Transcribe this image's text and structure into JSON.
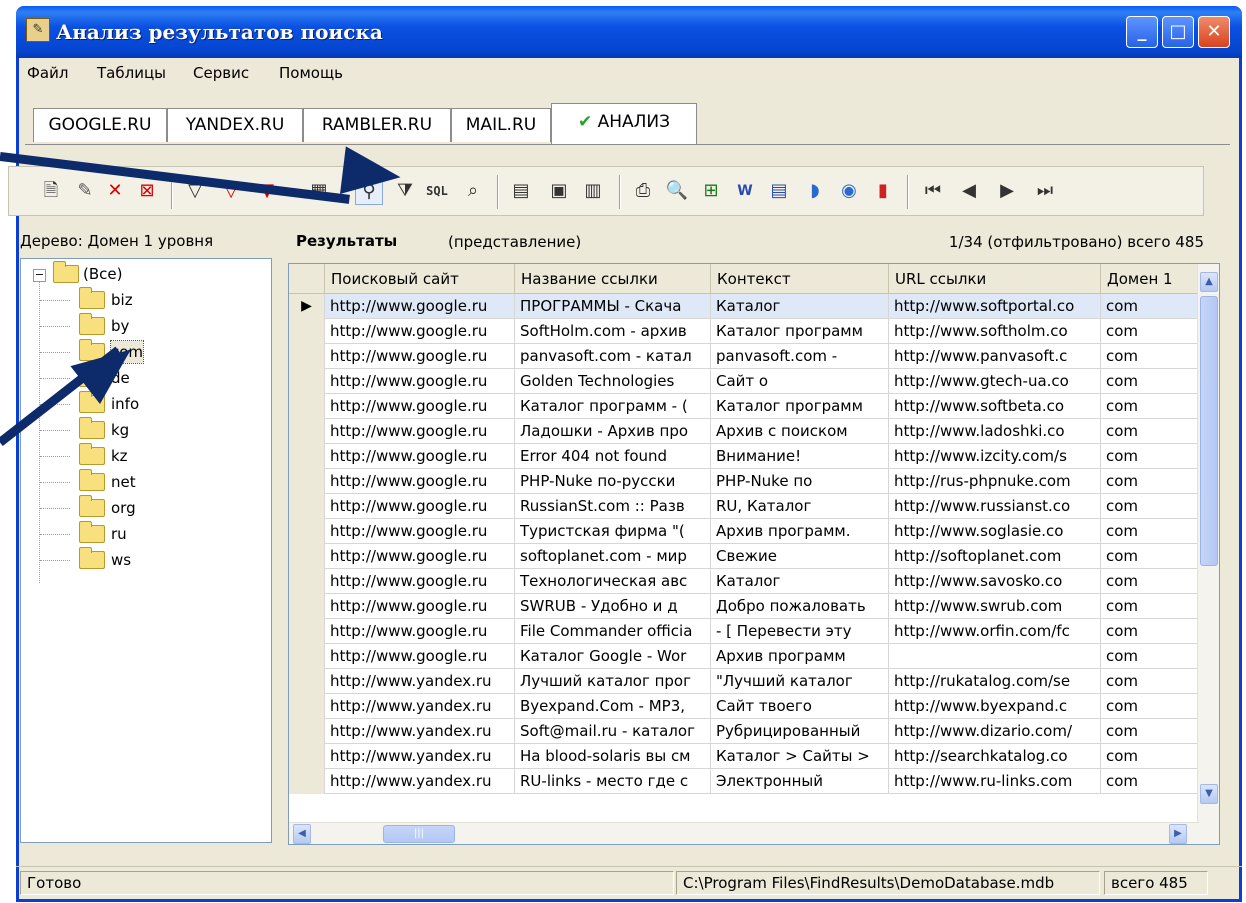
{
  "window": {
    "title": "Анализ результатов поиска",
    "colors": {
      "titlebar": "#0a50e4",
      "face": "#ece9d8",
      "selection": "#dfe8f6",
      "arrow": "#0d2a6b"
    }
  },
  "menu": {
    "items": [
      "Файл",
      "Таблицы",
      "Сервис",
      "Помощь"
    ]
  },
  "tabs": {
    "items": [
      "GOOGLE.RU",
      "YANDEX.RU",
      "RAMBLER.RU",
      "MAIL.RU",
      "АНАЛИЗ"
    ],
    "active": "АНАЛИЗ"
  },
  "toolbar": {
    "icons": [
      "new-record-icon",
      "edit-icon",
      "delete-icon",
      "delete-all-icon",
      "filter-icon",
      "filter-remove-icon",
      "filter-clear-icon",
      "filter-view-icon",
      "tree-filter-icon",
      "filter-builder-icon",
      "sql-icon",
      "binoculars-icon",
      "column-icon",
      "properties-icon",
      "properties-table-icon",
      "print-icon",
      "print-preview-icon",
      "excel-icon",
      "word-icon",
      "word-doc-icon",
      "export-icon",
      "browser-icon",
      "chart-icon",
      "first-icon",
      "prev-icon",
      "next-icon",
      "last-icon"
    ],
    "sql_label": "SQL"
  },
  "tree": {
    "label": "Дерево: Домен 1 уровня",
    "root": "(Все)",
    "items": [
      "biz",
      "by",
      "com",
      "de",
      "info",
      "kg",
      "kz",
      "net",
      "org",
      "ru",
      "ws"
    ],
    "selected": "com"
  },
  "results": {
    "title": "Результаты",
    "subtitle": "(представление)",
    "count": "1/34 (отфильтровано) всего 485"
  },
  "grid": {
    "columns": [
      "Поисковый сайт",
      "Название ссылки",
      "Контекст",
      "URL ссылки",
      "Домен 1"
    ],
    "rows": [
      [
        "http://www.google.ru",
        "ПРОГРАММЫ - Скача",
        "Каталог",
        "http://www.softportal.co",
        "com"
      ],
      [
        "http://www.google.ru",
        "SoftHolm.com - архив",
        "Каталог программ",
        "http://www.softholm.co",
        "com"
      ],
      [
        "http://www.google.ru",
        "panvasoft.com - катал",
        "panvasoft.com -",
        "http://www.panvasoft.c",
        "com"
      ],
      [
        "http://www.google.ru",
        "Golden Technologies",
        "Сайт о",
        "http://www.gtech-ua.co",
        "com"
      ],
      [
        "http://www.google.ru",
        "Каталог программ - (",
        "Каталог программ",
        "http://www.softbeta.co",
        "com"
      ],
      [
        "http://www.google.ru",
        "Ладошки - Архив про",
        "Архив с поиском",
        "http://www.ladoshki.co",
        "com"
      ],
      [
        "http://www.google.ru",
        "Error 404 not found",
        "Внимание!",
        "http://www.izcity.com/s",
        "com"
      ],
      [
        "http://www.google.ru",
        "PHP-Nuke по-русски",
        "PHP-Nuke по",
        "http://rus-phpnuke.com",
        "com"
      ],
      [
        "http://www.google.ru",
        "RussianSt.com :: Разв",
        "RU, Каталог",
        "http://www.russianst.co",
        "com"
      ],
      [
        "http://www.google.ru",
        "Туристская фирма \"(",
        "Архив программ.",
        "http://www.soglasie.co",
        "com"
      ],
      [
        "http://www.google.ru",
        "softoplanet.com - мир",
        "Свежие",
        "http://softoplanet.com",
        "com"
      ],
      [
        "http://www.google.ru",
        "Технологическая авс",
        "Каталог",
        "http://www.savosko.co",
        "com"
      ],
      [
        "http://www.google.ru",
        "SWRUB - Удобно и д",
        "Добро пожаловать",
        "http://www.swrub.com",
        "com"
      ],
      [
        "http://www.google.ru",
        "File Commander officia",
        "- [ Перевести эту",
        "http://www.orfin.com/fc",
        "com"
      ],
      [
        "http://www.google.ru",
        "Каталог Google - Wor",
        "Архив программ",
        "",
        "com"
      ],
      [
        "http://www.yandex.ru",
        "Лучший каталог прог",
        "\"Лучший каталог",
        "http://rukatalog.com/se",
        "com"
      ],
      [
        "http://www.yandex.ru",
        "Byexpand.Com - MP3,",
        "Сайт твоего",
        "http://www.byexpand.c",
        "com"
      ],
      [
        "http://www.yandex.ru",
        "Soft@mail.ru - каталог",
        "Рубрицированный",
        "http://www.dizario.com/",
        "com"
      ],
      [
        "http://www.yandex.ru",
        "На blood-solaris вы см",
        "Каталог > Сайты >",
        "http://searchkatalog.co",
        "com"
      ],
      [
        "http://www.yandex.ru",
        "RU-links - место где с",
        "Электронный",
        "http://www.ru-links.com",
        "com"
      ]
    ],
    "selected_row": 0
  },
  "status": {
    "text": "Готово",
    "path": "C:\\Program Files\\FindResults\\DemoDatabase.mdb",
    "total": "всего 485"
  }
}
